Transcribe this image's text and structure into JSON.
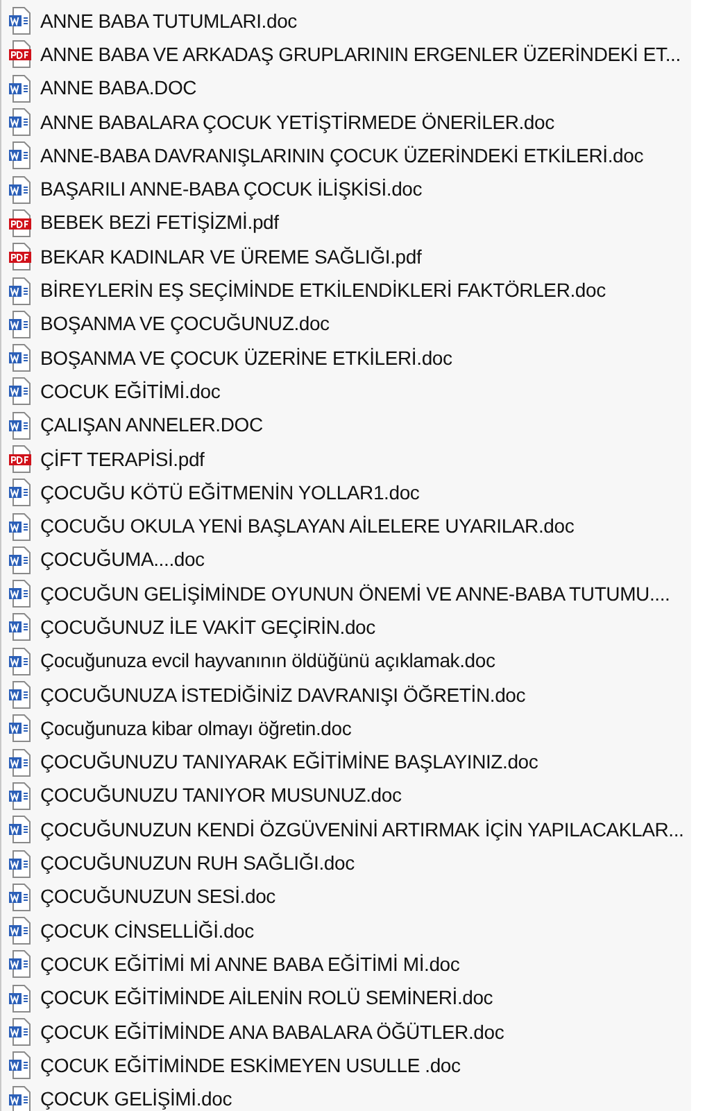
{
  "files": [
    {
      "kind": "doc",
      "name": "ANNE BABA TUTUMLARI.doc"
    },
    {
      "kind": "pdf",
      "name": "ANNE BABA VE ARKADAŞ GRUPLARININ ERGENLER ÜZERİNDEKİ ET..."
    },
    {
      "kind": "doc",
      "name": "ANNE BABA.DOC"
    },
    {
      "kind": "doc",
      "name": "ANNE BABALARA ÇOCUK YETİŞTİRMEDE ÖNERİLER.doc"
    },
    {
      "kind": "doc",
      "name": "ANNE-BABA DAVRANIŞLARININ ÇOCUK ÜZERİNDEKİ ETKİLERİ.doc"
    },
    {
      "kind": "doc",
      "name": "BAŞARILI ANNE-BABA ÇOCUK İLİŞKİSİ.doc"
    },
    {
      "kind": "pdf",
      "name": "BEBEK BEZİ FETİŞİZMİ.pdf"
    },
    {
      "kind": "pdf",
      "name": "BEKAR KADINLAR VE ÜREME SAĞLIĞI.pdf"
    },
    {
      "kind": "doc",
      "name": "BİREYLERİN EŞ SEÇİMİNDE ETKİLENDİKLERİ FAKTÖRLER.doc"
    },
    {
      "kind": "doc",
      "name": "BOŞANMA VE ÇOCUĞUNUZ.doc"
    },
    {
      "kind": "doc",
      "name": "BOŞANMA VE ÇOCUK ÜZERİNE ETKİLERİ.doc"
    },
    {
      "kind": "doc",
      "name": "COCUK EĞİTİMİ.doc"
    },
    {
      "kind": "doc",
      "name": "ÇALIŞAN ANNELER.DOC"
    },
    {
      "kind": "pdf",
      "name": "ÇİFT TERAPİSİ.pdf"
    },
    {
      "kind": "doc",
      "name": "ÇOCUĞU KÖTÜ EĞİTMENİN YOLLAR1.doc"
    },
    {
      "kind": "doc",
      "name": "ÇOCUĞU OKULA YENİ BAŞLAYAN AİLELERE UYARILAR.doc"
    },
    {
      "kind": "doc",
      "name": "ÇOCUĞUMA....doc"
    },
    {
      "kind": "doc",
      "name": "ÇOCUĞUN GELİŞİMİNDE OYUNUN ÖNEMİ VE ANNE-BABA TUTUMU...."
    },
    {
      "kind": "doc",
      "name": "ÇOCUĞUNUZ İLE VAKİT GEÇİRİN.doc"
    },
    {
      "kind": "doc",
      "name": "Çocuğunuza evcil hayvanının öldüğünü açıklamak.doc"
    },
    {
      "kind": "doc",
      "name": "ÇOCUĞUNUZA İSTEDİĞİNİZ DAVRANIŞI ÖĞRETİN.doc"
    },
    {
      "kind": "doc",
      "name": "Çocuğunuza kibar olmayı öğretin.doc"
    },
    {
      "kind": "doc",
      "name": "ÇOCUĞUNUZU TANIYARAK EĞİTİMİNE BAŞLAYINIZ.doc"
    },
    {
      "kind": "doc",
      "name": "ÇOCUĞUNUZU TANIYOR MUSUNUZ.doc"
    },
    {
      "kind": "doc",
      "name": "ÇOCUĞUNUZUN KENDİ ÖZGÜVENİNİ ARTIRMAK İÇİN YAPILACAKLAR..."
    },
    {
      "kind": "doc",
      "name": "ÇOCUĞUNUZUN RUH SAĞLIĞI.doc"
    },
    {
      "kind": "doc",
      "name": "ÇOCUĞUNUZUN SESİ.doc"
    },
    {
      "kind": "doc",
      "name": "ÇOCUK CİNSELLİĞİ.doc"
    },
    {
      "kind": "doc",
      "name": "ÇOCUK EĞİTİMİ Mİ ANNE BABA EĞİTİMİ Mİ.doc"
    },
    {
      "kind": "doc",
      "name": "ÇOCUK EĞİTİMİNDE AİLENİN ROLÜ SEMİNERİ.doc"
    },
    {
      "kind": "doc",
      "name": "ÇOCUK EĞİTİMİNDE ANA BABALARA ÖĞÜTLER.doc"
    },
    {
      "kind": "doc",
      "name": "ÇOCUK EĞİTİMİNDE ESKİMEYEN USULLE .doc"
    },
    {
      "kind": "doc",
      "name": "ÇOCUK GELİŞİMİ.doc"
    }
  ]
}
